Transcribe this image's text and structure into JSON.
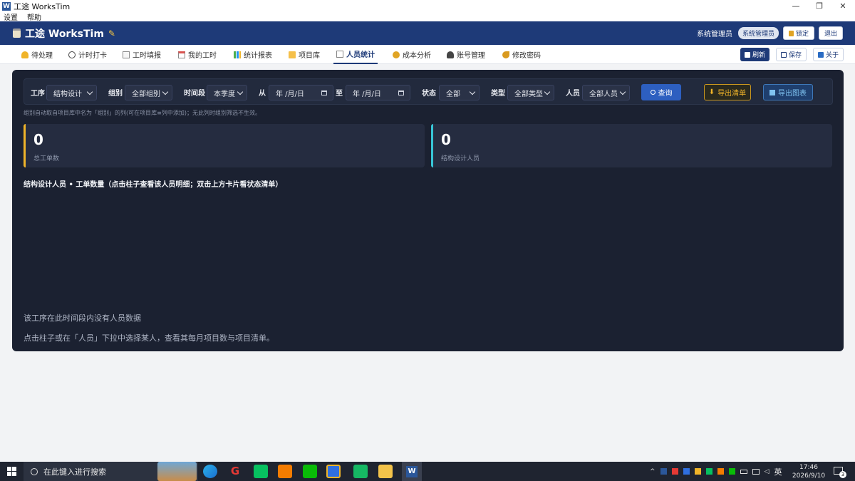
{
  "window": {
    "title": "工途 WorksTim",
    "logo": "W",
    "minimize": "—",
    "maximize": "❐",
    "close": "✕"
  },
  "menu": [
    "设置",
    "帮助"
  ],
  "header": {
    "app_name": "工途 WorksTim",
    "user_name": "系统管理员",
    "role_badge": "系统管理员",
    "lock_label": "锁定",
    "logout_label": "退出"
  },
  "tabs": [
    {
      "label": "待处理",
      "icon": "bell-icon"
    },
    {
      "label": "计时打卡",
      "icon": "stopwatch-icon"
    },
    {
      "label": "工时填报",
      "icon": "form-icon"
    },
    {
      "label": "我的工时",
      "icon": "calendar-icon"
    },
    {
      "label": "统计报表",
      "icon": "bar-chart-icon"
    },
    {
      "label": "项目库",
      "icon": "folder-icon"
    },
    {
      "label": "人员统计",
      "icon": "checklist-icon"
    },
    {
      "label": "成本分析",
      "icon": "money-bag-icon"
    },
    {
      "label": "账号管理",
      "icon": "users-icon"
    },
    {
      "label": "修改密码",
      "icon": "key-icon"
    }
  ],
  "actions": {
    "refresh": "刷新",
    "save": "保存",
    "about": "关于"
  },
  "filter": {
    "process_label": "工序",
    "process_value": "结构设计",
    "group_label": "组别",
    "group_value": "全部组别",
    "period_label": "时间段",
    "period_value": "本季度",
    "from_label": "从",
    "from_value": "年 /月/日",
    "to_label": "至",
    "to_value": "年 /月/日",
    "status_label": "状态",
    "status_value": "全部",
    "type_label": "类型",
    "type_value": "全部类型",
    "person_label": "人员",
    "person_value": "全部人员",
    "query_label": "查询",
    "export_list_label": "导出清单",
    "export_chart_label": "导出图表"
  },
  "hint": "组别自动取自项目库中名为「组别」的列(可在项目库≡列中添加)；无此列时组别筛选不生效。",
  "cards": [
    {
      "value": "0",
      "label": "总工单数",
      "accent": "#f0b429"
    },
    {
      "value": "0",
      "label": "结构设计人员",
      "accent": "#38c5d6"
    }
  ],
  "chart": {
    "title": "结构设计人员 • 工单数量（点击柱子查看该人员明细；双击上方卡片看状态清单）",
    "empty_message": "该工序在此时间段内没有人员数据",
    "empty_hint": "点击柱子或在「人员」下拉中选择某人，查看其每月项目数与项目清单。"
  },
  "taskbar": {
    "search_placeholder": "在此键入进行搜索",
    "ime": "英",
    "time": "17:46",
    "date": "2026/9/10",
    "notification_count": "3"
  },
  "colors": {
    "header_bg": "#1e3a78",
    "panel_bg": "#1b2131",
    "accent_gold": "#f0b429",
    "accent_cyan": "#38c5d6"
  }
}
